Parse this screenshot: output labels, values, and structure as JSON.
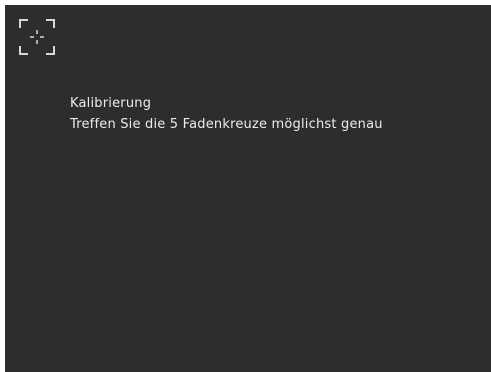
{
  "screen": {
    "background": "#2d2d2d",
    "icon": "calibration-crosshair-icon"
  },
  "calibration": {
    "title": "Kalibrierung",
    "instruction": "Treffen Sie die 5 Fadenkreuze möglichst genau"
  }
}
